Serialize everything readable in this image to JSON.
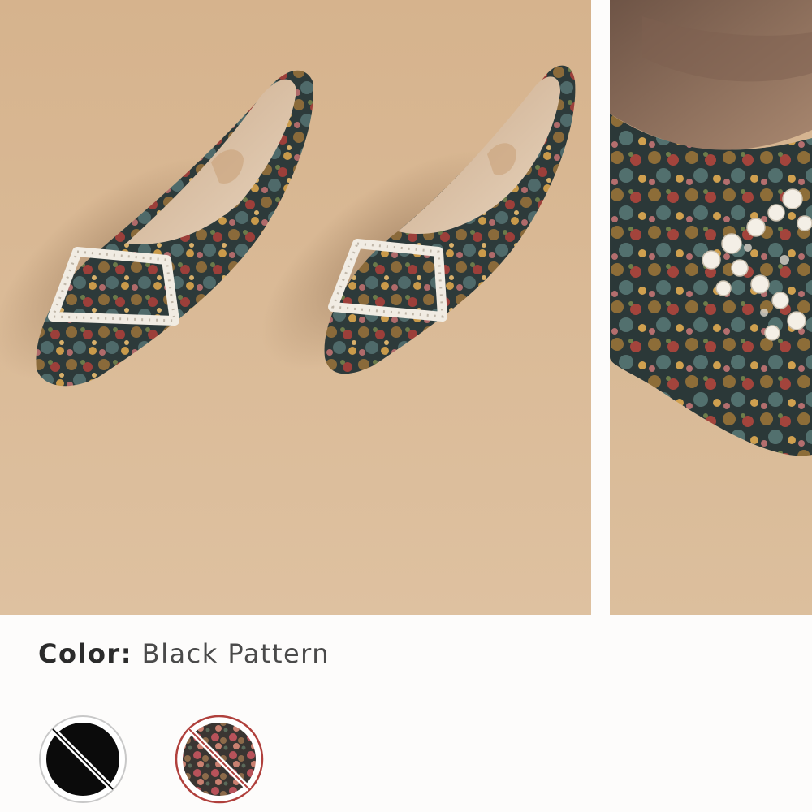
{
  "product": {
    "color_label": "Color:",
    "color_value": "Black Pattern"
  },
  "gallery": {
    "images": [
      {
        "name": "pair-of-tapestry-pointed-flats-with-pearl-buckle"
      },
      {
        "name": "close-up-of-pearl-buckle-on-tapestry-flat"
      }
    ]
  },
  "swatches": [
    {
      "name": "Black",
      "color": "#0b0b0b",
      "available": false
    },
    {
      "name": "Pink Tapestry",
      "color": "#b8525a",
      "available": false,
      "selected": true
    }
  ],
  "colors": {
    "background": "#fdfcfb",
    "photo_backdrop": "#d9b894",
    "text": "#2b2b2b",
    "selected_ring": "#b0403c",
    "unselected_ring": "#c8c8c8"
  }
}
